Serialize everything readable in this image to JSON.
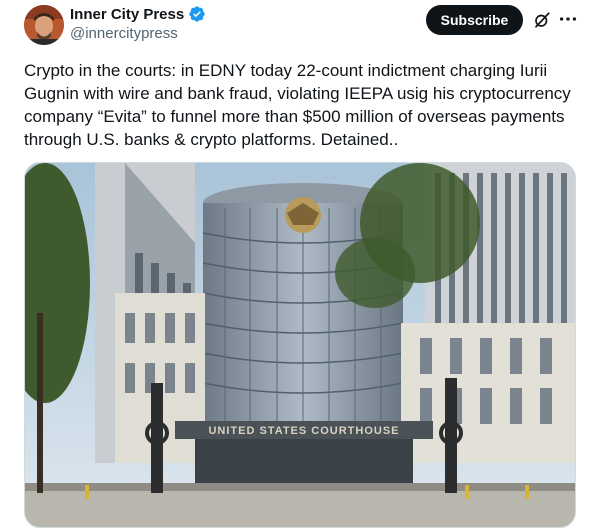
{
  "author": {
    "name": "Inner City Press",
    "handle": "@innercitypress",
    "verified": true,
    "avatar_icon": "avatar-photo"
  },
  "actions": {
    "subscribe_label": "Subscribe",
    "grok_icon": "grok-icon",
    "more_icon": "more-icon"
  },
  "post": {
    "text": "Crypto in the courts: in EDNY today 22-count indictment charging Iurii Gugnin with wire and bank fraud, violating IEEPA usig his cryptocurrency company “Evita” to funnel more than $500 million of overseas payments through U.S. banks & crypto platforms. Detained.."
  },
  "media": {
    "image_icon": "courthouse-photo",
    "building_sign": "UNITED STATES COURTHOUSE"
  },
  "colors": {
    "primary_text": "#0f1419",
    "secondary_text": "#536471",
    "verified_blue": "#1d9bf0",
    "button_bg": "#0f1419"
  }
}
